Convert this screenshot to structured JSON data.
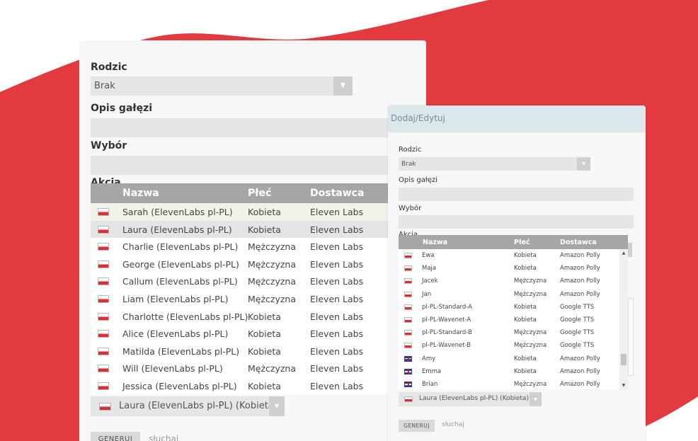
{
  "colors": {
    "brand_red": "#e23a3f",
    "panel_bg": "#f7f7f7",
    "grid_header": "#a6a6a6",
    "field_bg": "#e6e6e6",
    "dialog_title_bg": "#dce7ec"
  },
  "left": {
    "parent_label": "Rodzic",
    "parent_value": "Brak",
    "desc_label": "Opis gałęzi",
    "choice_label": "Wybór",
    "action_label": "Akcja",
    "columns": [
      "Nazwa",
      "Płeć",
      "Dostawca"
    ],
    "rows": [
      {
        "flag": "pl-flag-icon",
        "name": "Sarah (ElevenLabs pl-PL)",
        "gender": "Kobieta",
        "provider": "Eleven Labs"
      },
      {
        "flag": "pl-flag-icon",
        "name": "Laura (ElevenLabs pl-PL)",
        "gender": "Kobieta",
        "provider": "Eleven Labs"
      },
      {
        "flag": "pl-flag-icon",
        "name": "Charlie (ElevenLabs pl-PL)",
        "gender": "Mężczyzna",
        "provider": "Eleven Labs"
      },
      {
        "flag": "pl-flag-icon",
        "name": "George (ElevenLabs pl-PL)",
        "gender": "Mężczyzna",
        "provider": "Eleven Labs"
      },
      {
        "flag": "pl-flag-icon",
        "name": "Callum (ElevenLabs pl-PL)",
        "gender": "Mężczyzna",
        "provider": "Eleven Labs"
      },
      {
        "flag": "pl-flag-icon",
        "name": "Liam (ElevenLabs pl-PL)",
        "gender": "Mężczyzna",
        "provider": "Eleven Labs"
      },
      {
        "flag": "pl-flag-icon",
        "name": "Charlotte (ElevenLabs pl-PL)",
        "gender": "Kobieta",
        "provider": "Eleven Labs"
      },
      {
        "flag": "pl-flag-icon",
        "name": "Alice (ElevenLabs pl-PL)",
        "gender": "Kobieta",
        "provider": "Eleven Labs"
      },
      {
        "flag": "pl-flag-icon",
        "name": "Matilda (ElevenLabs pl-PL)",
        "gender": "Kobieta",
        "provider": "Eleven Labs"
      },
      {
        "flag": "pl-flag-icon",
        "name": "Will (ElevenLabs pl-PL)",
        "gender": "Mężczyzna",
        "provider": "Eleven Labs"
      },
      {
        "flag": "pl-flag-icon",
        "name": "Jessica (ElevenLabs pl-PL)",
        "gender": "Kobieta",
        "provider": "Eleven Labs"
      }
    ],
    "selected_voice": "Laura (ElevenLabs pl-PL) (Kobieta)",
    "generate_label": "GENERUJ",
    "listen_label": "słuchaj"
  },
  "right": {
    "title": "Dodaj/Edytuj",
    "parent_label": "Rodzic",
    "parent_value": "Brak",
    "desc_label": "Opis gałęzi",
    "choice_label": "Wybór",
    "action_label": "Akcja",
    "columns": [
      "Nazwa",
      "Płeć",
      "Dostawca"
    ],
    "rows": [
      {
        "flag": "pl-flag-icon",
        "name": "Ewa",
        "gender": "Kobieta",
        "provider": "Amazon Polly"
      },
      {
        "flag": "pl-flag-icon",
        "name": "Maja",
        "gender": "Kobieta",
        "provider": "Amazon Polly"
      },
      {
        "flag": "pl-flag-icon",
        "name": "Jacek",
        "gender": "Mężczyzna",
        "provider": "Amazon Polly"
      },
      {
        "flag": "pl-flag-icon",
        "name": "Jan",
        "gender": "Mężczyzna",
        "provider": "Amazon Polly"
      },
      {
        "flag": "pl-flag-icon",
        "name": "pl-PL-Standard-A",
        "gender": "Kobieta",
        "provider": "Google TTS"
      },
      {
        "flag": "pl-flag-icon",
        "name": "pl-PL-Wavenet-A",
        "gender": "Kobieta",
        "provider": "Google TTS"
      },
      {
        "flag": "pl-flag-icon",
        "name": "pl-PL-Standard-B",
        "gender": "Mężczyzna",
        "provider": "Google TTS"
      },
      {
        "flag": "pl-flag-icon",
        "name": "pl-PL-Wavenet-B",
        "gender": "Mężczyzna",
        "provider": "Google TTS"
      },
      {
        "flag": "gb-flag-icon",
        "name": "Amy",
        "gender": "Kobieta",
        "provider": "Amazon Polly"
      },
      {
        "flag": "gb-flag-icon",
        "name": "Emma",
        "gender": "Kobieta",
        "provider": "Amazon Polly"
      },
      {
        "flag": "gb-flag-icon",
        "name": "Brian",
        "gender": "Mężczyzna",
        "provider": "Amazon Polly"
      }
    ],
    "selected_voice": "Laura (ElevenLabs pl-PL) (Kobieta)",
    "generate_label": "GENERUJ",
    "listen_label": "słuchaj"
  }
}
